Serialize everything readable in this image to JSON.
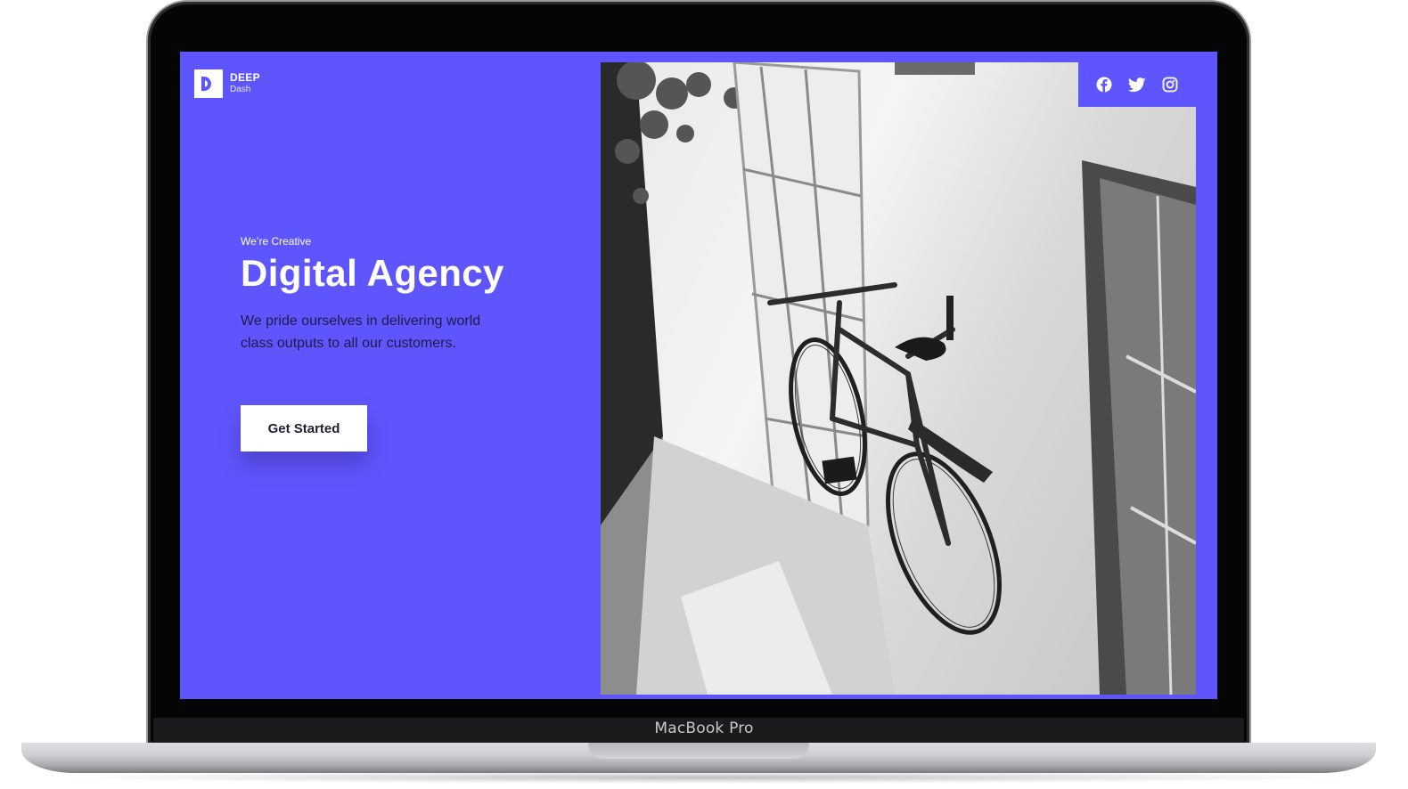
{
  "device": {
    "label": "MacBook Pro"
  },
  "brand": {
    "name": "DEEP",
    "sub": "Dash",
    "color": "#5f55fc"
  },
  "hero": {
    "eyebrow": "We’re Creative",
    "title": "Digital Agency",
    "lead": "We pride ourselves in delivering world class outputs to all our customers.",
    "cta_label": "Get Started"
  },
  "social": {
    "icons": [
      "facebook-icon",
      "twitter-icon",
      "instagram-icon"
    ]
  },
  "photo": {
    "subject": "bicycle-photo"
  }
}
